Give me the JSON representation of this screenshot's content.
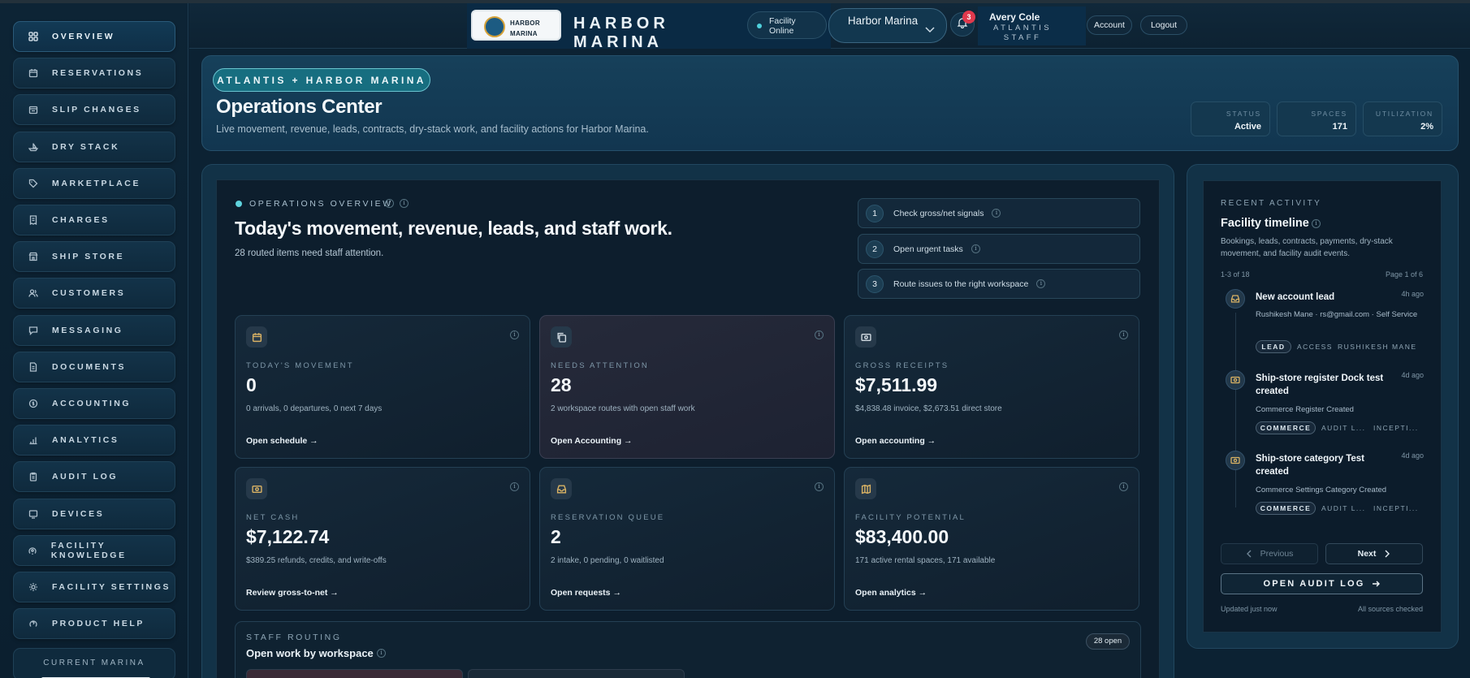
{
  "sidebar": {
    "items": [
      {
        "label": "OVERVIEW",
        "icon": "grid-icon",
        "active": true
      },
      {
        "label": "RESERVATIONS",
        "icon": "calendar-icon"
      },
      {
        "label": "SLIP CHANGES",
        "icon": "calendar-swap-icon"
      },
      {
        "label": "DRY STACK",
        "icon": "boat-icon"
      },
      {
        "label": "MARKETPLACE",
        "icon": "tag-icon"
      },
      {
        "label": "CHARGES",
        "icon": "receipt-icon"
      },
      {
        "label": "SHIP STORE",
        "icon": "store-icon"
      },
      {
        "label": "CUSTOMERS",
        "icon": "users-icon"
      },
      {
        "label": "MESSAGING",
        "icon": "message-icon"
      },
      {
        "label": "DOCUMENTS",
        "icon": "document-icon"
      },
      {
        "label": "ACCOUNTING",
        "icon": "coin-icon"
      },
      {
        "label": "ANALYTICS",
        "icon": "chart-icon"
      },
      {
        "label": "AUDIT LOG",
        "icon": "clipboard-icon"
      },
      {
        "label": "DEVICES",
        "icon": "device-icon"
      },
      {
        "label": "FACILITY KNOWLEDGE",
        "icon": "knowledge-icon"
      },
      {
        "label": "FACILITY SETTINGS",
        "icon": "gear-icon"
      },
      {
        "label": "PRODUCT HELP",
        "icon": "help-icon"
      }
    ],
    "current_marina_label": "CURRENT MARINA"
  },
  "header": {
    "logo_text": "HARBOR MARINA",
    "brand_line1": "HARBOR",
    "brand_line2": "MARINA",
    "facility_status_line1": "Facility",
    "facility_status_line2": "Online",
    "marina_select": "Harbor Marina",
    "notification_count": "3",
    "user_name": "Avery Cole",
    "user_role": "ATLANTIS STAFF",
    "account_label": "Account",
    "logout_label": "Logout"
  },
  "hero": {
    "pill": "ATLANTIS + HARBOR MARINA",
    "title": "Operations Center",
    "subtitle": "Live movement, revenue, leads, contracts, dry-stack work, and facility actions for Harbor Marina.",
    "stats": [
      {
        "label": "STATUS",
        "value": "Active"
      },
      {
        "label": "SPACES",
        "value": "171"
      },
      {
        "label": "UTILIZATION",
        "value": "2%"
      }
    ]
  },
  "overview": {
    "kicker": "OPERATIONS OVERVIEW",
    "title": "Today's movement, revenue, leads, and staff work.",
    "subtitle": "28 routed items need staff attention.",
    "steps": [
      {
        "num": "1",
        "text": "Check gross/net signals"
      },
      {
        "num": "2",
        "text": "Open urgent tasks"
      },
      {
        "num": "3",
        "text": "Route issues to the right workspace"
      }
    ],
    "kpis": [
      {
        "label": "TODAY'S MOVEMENT",
        "value": "0",
        "desc": "0 arrivals, 0 departures, 0 next 7 days",
        "link": "Open schedule →",
        "icon": "calendar-icon",
        "icon_color": "#d9b264"
      },
      {
        "label": "NEEDS ATTENTION",
        "value": "28",
        "desc": "2 workspace routes with open staff work",
        "link": "Open Accounting →",
        "icon": "copy-icon",
        "icon_color": "#cfd8df"
      },
      {
        "label": "GROSS RECEIPTS",
        "value": "$7,511.99",
        "desc": "$4,838.48 invoice, $2,673.51 direct store",
        "link": "Open accounting →",
        "icon": "cash-icon",
        "icon_color": "#cfd8df"
      },
      {
        "label": "NET CASH",
        "value": "$7,122.74",
        "desc": "$389.25 refunds, credits, and write-offs",
        "link": "Review gross-to-net →",
        "icon": "cash-icon",
        "icon_color": "#d9b264"
      },
      {
        "label": "RESERVATION QUEUE",
        "value": "2",
        "desc": "2 intake, 0 pending, 0 waitlisted",
        "link": "Open requests →",
        "icon": "inbox-icon",
        "icon_color": "#d9b264"
      },
      {
        "label": "FACILITY POTENTIAL",
        "value": "$83,400.00",
        "desc": "171 active rental spaces, 171 available",
        "link": "Open analytics →",
        "icon": "map-icon",
        "icon_color": "#d9b264"
      }
    ]
  },
  "routing": {
    "kicker": "STAFF ROUTING",
    "title": "Open work by workspace",
    "badge": "28 open"
  },
  "activity": {
    "kicker": "RECENT ACTIVITY",
    "title": "Facility timeline",
    "description": "Bookings, leads, contracts, payments, dry-stack movement, and facility audit events.",
    "count": "1-3 of 18",
    "page": "Page 1 of 6",
    "items": [
      {
        "title": "New account lead",
        "time": "4h ago",
        "sub": "Rushikesh Mane · rs@gmail.com · Self Service",
        "tag": "LEAD",
        "tag2": "ACCESS",
        "tag3": "RUSHIKESH MANE",
        "icon": "inbox-icon"
      },
      {
        "title": "Ship-store register Dock test created",
        "time": "4d ago",
        "sub": "Commerce Register Created",
        "tag": "COMMERCE",
        "tag2": "AUDIT L...",
        "tag3": "INCEPTI...",
        "icon": "cash-icon"
      },
      {
        "title": "Ship-store category Test created",
        "time": "4d ago",
        "sub": "Commerce Settings Category Created",
        "tag": "COMMERCE",
        "tag2": "AUDIT L...",
        "tag3": "INCEPTI...",
        "icon": "cash-icon"
      }
    ],
    "prev_label": "Previous",
    "next_label": "Next",
    "audit_label": "OPEN AUDIT LOG",
    "footer_left": "Updated just now",
    "footer_right": "All sources checked"
  },
  "colors": {
    "accent": "#5fd3dd",
    "alert": "#e0394d",
    "gold": "#d9b264"
  }
}
